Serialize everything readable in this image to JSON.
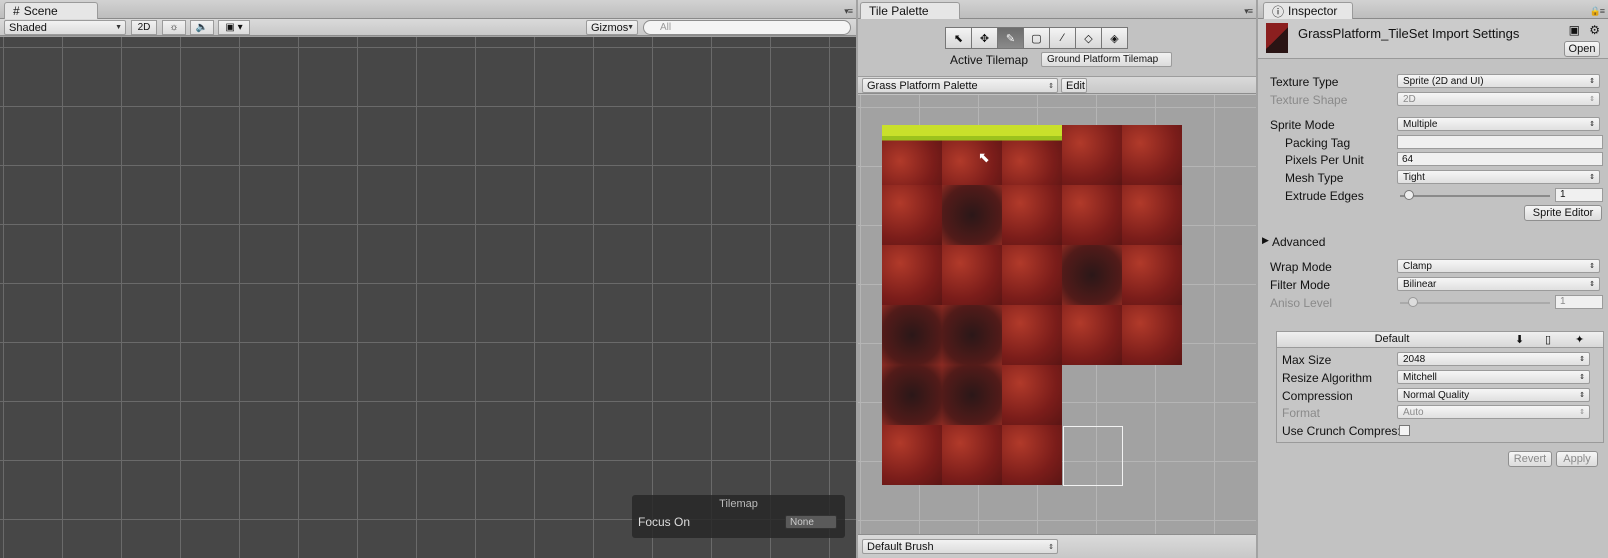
{
  "scene": {
    "tab": "Scene",
    "shading": "Shaded",
    "mode2d": "2D",
    "gizmos": "Gizmos",
    "search_placeholder": "All",
    "overlay_title": "Tilemap",
    "focus_label": "Focus On",
    "focus_value": "None"
  },
  "palette": {
    "tab": "Tile Palette",
    "active_label": "Active Tilemap",
    "active_value": "Ground Platform Tilemap",
    "palette_name": "Grass Platform Palette",
    "edit": "Edit",
    "brush": "Default Brush"
  },
  "inspector": {
    "tab": "Inspector",
    "title": "GrassPlatform_TileSet Import Settings",
    "open": "Open",
    "texture_type_label": "Texture Type",
    "texture_type": "Sprite (2D and UI)",
    "texture_shape_label": "Texture Shape",
    "texture_shape": "2D",
    "sprite_mode_label": "Sprite Mode",
    "sprite_mode": "Multiple",
    "packing_tag_label": "Packing Tag",
    "packing_tag": "",
    "ppu_label": "Pixels Per Unit",
    "ppu": "64",
    "mesh_type_label": "Mesh Type",
    "mesh_type": "Tight",
    "extrude_label": "Extrude Edges",
    "extrude": "1",
    "sprite_editor": "Sprite Editor",
    "advanced": "Advanced",
    "wrap_label": "Wrap Mode",
    "wrap": "Clamp",
    "filter_label": "Filter Mode",
    "filter": "Bilinear",
    "aniso_label": "Aniso Level",
    "aniso": "1",
    "platform": "Default",
    "max_size_label": "Max Size",
    "max_size": "2048",
    "resize_label": "Resize Algorithm",
    "resize": "Mitchell",
    "compression_label": "Compression",
    "compression": "Normal Quality",
    "format_label": "Format",
    "format": "Auto",
    "crunch_label": "Use Crunch Compres:",
    "revert": "Revert",
    "apply": "Apply"
  }
}
